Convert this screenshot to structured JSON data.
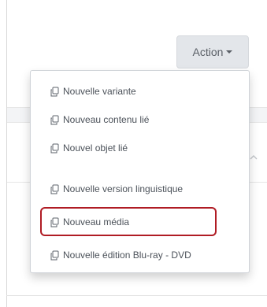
{
  "action_button": {
    "label": "Action",
    "caret_icon": "caret-down-icon"
  },
  "dropdown": {
    "item_icon": "copy-icon",
    "items": [
      {
        "label": "Nouvelle variante"
      },
      {
        "label": "Nouveau contenu lié"
      },
      {
        "label": "Nouvel objet lié"
      },
      {
        "label": "Nouvelle version linguistique"
      },
      {
        "label": "Nouveau média",
        "highlighted": true
      },
      {
        "label": "Nouvelle édition Blu-ray - DVD"
      }
    ]
  },
  "colors": {
    "highlight": "#b01c24",
    "button_bg": "#e3e6ea",
    "text": "#4b5159"
  }
}
